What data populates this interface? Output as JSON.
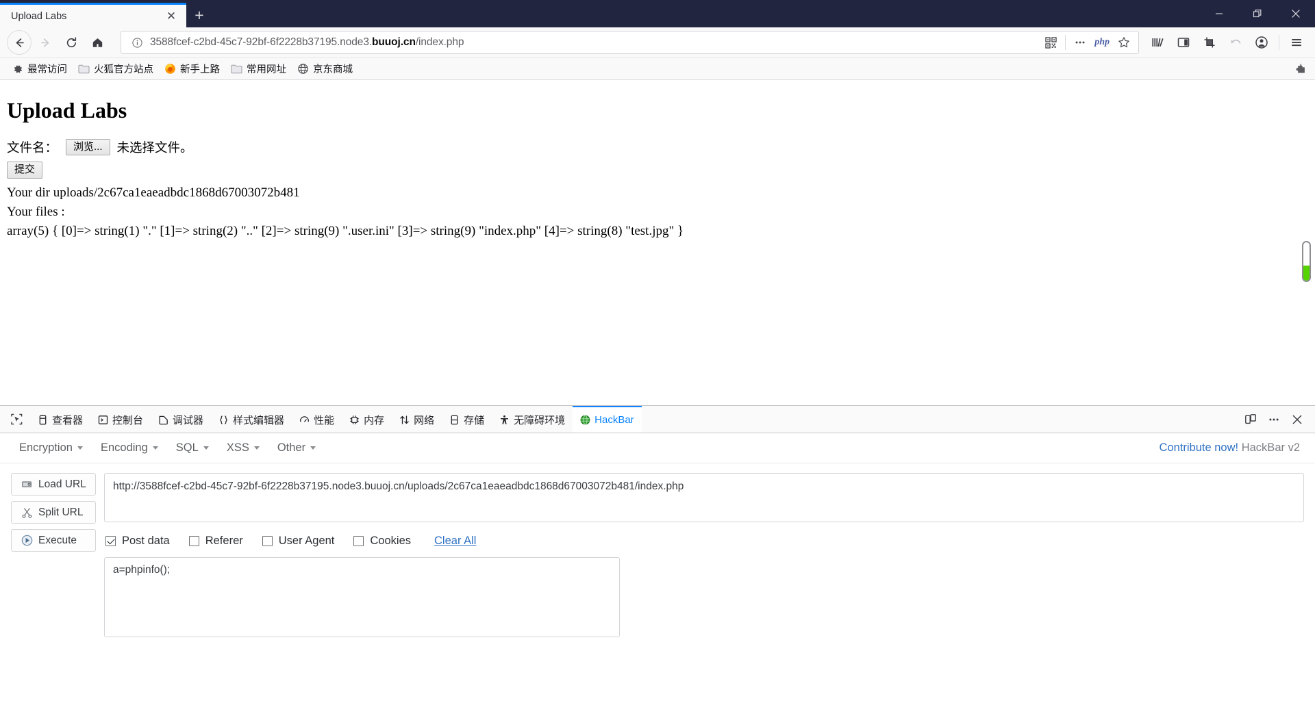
{
  "window": {
    "minimize_label": "Minimize",
    "restore_label": "Restore",
    "close_label": "Close"
  },
  "tabs": {
    "active_title": "Upload Labs",
    "close_glyph": "✕",
    "newtab_glyph": "+"
  },
  "nav": {
    "back_label": "Back",
    "forward_label": "Forward",
    "reload_label": "Reload",
    "home_label": "Home"
  },
  "urlbar": {
    "prefix": "3588fcef-c2bd-45c7-92bf-6f2228b37195.node3.",
    "domain": "buuoj.cn",
    "suffix": "/index.php",
    "full": "3588fcef-c2bd-45c7-92bf-6f2228b37195.node3.buuoj.cn/index.php",
    "php_badge": "php",
    "info_glyph": "i"
  },
  "bookmarks": [
    {
      "label": "最常访问",
      "icon": "gear-icon"
    },
    {
      "label": "火狐官方站点",
      "icon": "folder-icon"
    },
    {
      "label": "新手上路",
      "icon": "firefox-icon"
    },
    {
      "label": "常用网址",
      "icon": "folder-icon"
    },
    {
      "label": "京东商城",
      "icon": "globe-icon"
    }
  ],
  "page": {
    "heading": "Upload Labs",
    "file_label": "文件名：",
    "browse_button": "浏览...",
    "no_file_text": "未选择文件。",
    "submit_button": "提交",
    "your_dir": "Your dir uploads/2c67ca1eaeadbdc1868d67003072b481",
    "your_files": "Your files :",
    "array_dump": "array(5) { [0]=> string(1) \".\" [1]=> string(2) \"..\" [2]=> string(9) \".user.ini\" [3]=> string(9) \"index.php\" [4]=> string(8) \"test.jpg\" }"
  },
  "devtools": {
    "picker_icon": "element-picker-icon",
    "tabs": [
      {
        "label": "查看器",
        "icon": "inspector-icon",
        "active": false
      },
      {
        "label": "控制台",
        "icon": "console-icon",
        "active": false
      },
      {
        "label": "调试器",
        "icon": "debugger-icon",
        "active": false
      },
      {
        "label": "样式编辑器",
        "icon": "style-editor-icon",
        "active": false
      },
      {
        "label": "性能",
        "icon": "performance-icon",
        "active": false
      },
      {
        "label": "内存",
        "icon": "memory-icon",
        "active": false
      },
      {
        "label": "网络",
        "icon": "network-icon",
        "active": false
      },
      {
        "label": "存储",
        "icon": "storage-icon",
        "active": false
      },
      {
        "label": "无障碍环境",
        "icon": "accessibility-icon",
        "active": false
      },
      {
        "label": "HackBar",
        "icon": "hackbar-icon",
        "active": true
      }
    ],
    "responsive_label": "Responsive Design Mode",
    "meatball_label": "Customize",
    "close_label": "Close DevTools",
    "accent_color": "#0a84ff"
  },
  "hackbar": {
    "menus": [
      "Encryption",
      "Encoding",
      "SQL",
      "XSS",
      "Other"
    ],
    "contribute_link": "Contribute now!",
    "version_label": "HackBar v2",
    "actions": [
      {
        "label": "Load URL",
        "icon": "load-url-icon"
      },
      {
        "label": "Split URL",
        "icon": "split-url-icon"
      },
      {
        "label": "Execute",
        "icon": "execute-icon"
      }
    ],
    "url_value": "http://3588fcef-c2bd-45c7-92bf-6f2228b37195.node3.buuoj.cn/uploads/2c67ca1eaeadbdc1868d67003072b481/index.php",
    "options": [
      {
        "label": "Post data",
        "checked": true
      },
      {
        "label": "Referer",
        "checked": false
      },
      {
        "label": "User Agent",
        "checked": false
      },
      {
        "label": "Cookies",
        "checked": false
      }
    ],
    "clear_all": "Clear All",
    "post_data_value": "a=phpinfo();",
    "link_color": "#2f72c4"
  }
}
